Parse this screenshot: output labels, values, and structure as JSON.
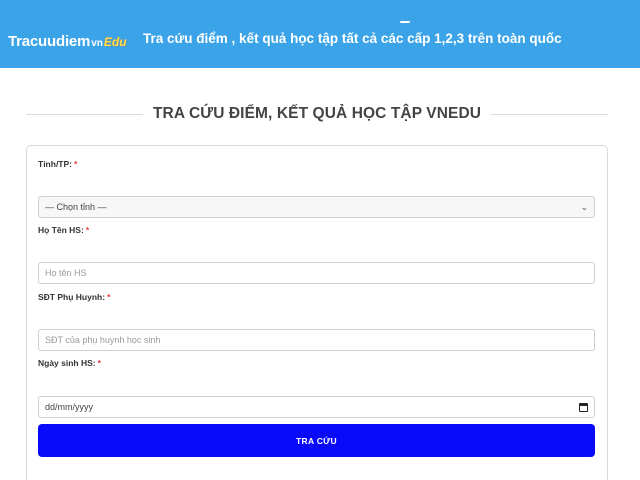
{
  "header": {
    "logo": {
      "main": "Tracuudiem",
      "vn": "vn",
      "edu": "Edu"
    },
    "tagline": "Tra cứu điểm , kết quả học tập tất cả các cấp 1,2,3 trên toàn quốc"
  },
  "section_title": "TRA CỨU ĐIỂM, KẾT QUẢ HỌC TẬP VNEDU",
  "form": {
    "province": {
      "label": "Tỉnh/TP:",
      "required": "*",
      "selected": "— Chọn tỉnh —",
      "icon": "chevron-down-icon"
    },
    "student_name": {
      "label": "Họ Tên HS:",
      "required": "*",
      "placeholder": "Họ tên HS"
    },
    "parent_phone": {
      "label": "SĐT Phụ Huynh:",
      "required": "*",
      "placeholder": "SĐT của phụ huynh học sinh"
    },
    "birthdate": {
      "label": "Ngày sinh HS:",
      "required": "*",
      "placeholder": "dd/mm/yyyy",
      "icon": "calendar-icon"
    },
    "submit_label": "TRA CỨU"
  },
  "colors": {
    "header_bg": "#3ba4e8",
    "submit_bg": "#0a0afa",
    "required": "#e53935"
  }
}
